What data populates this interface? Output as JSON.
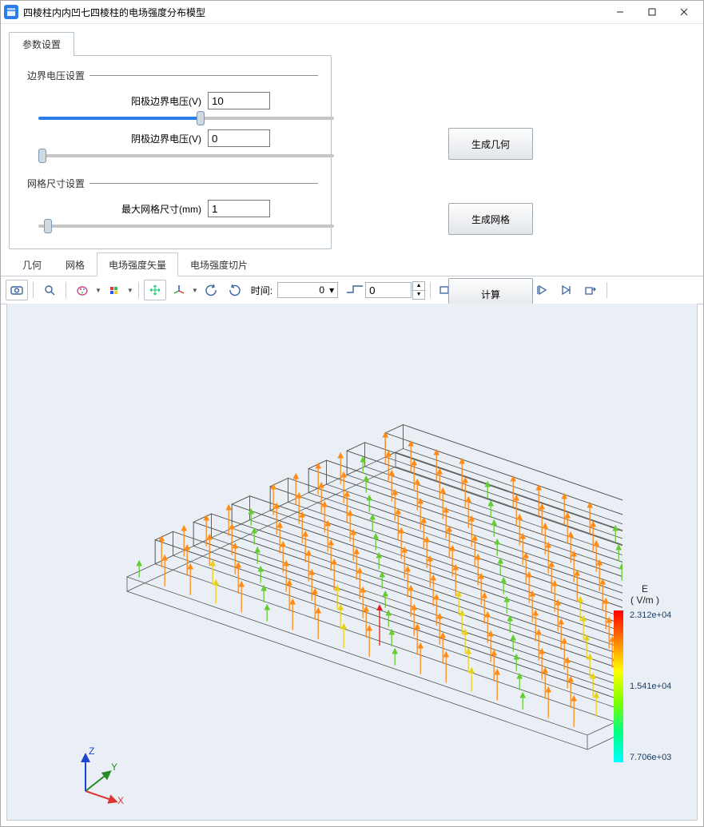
{
  "window": {
    "title": "四棱柱内内凹七四棱柱的电场强度分布模型"
  },
  "params_tab": "参数设置",
  "sections": {
    "voltage_title": "边界电压设置",
    "mesh_title": "网格尺寸设置"
  },
  "fields": {
    "anode_label": "阳极边界电压(V)",
    "anode_value": "10",
    "cathode_label": "阴极边界电压(V)",
    "cathode_value": "0",
    "mesh_label": "最大网格尺寸(mm)",
    "mesh_value": "1"
  },
  "actions": {
    "gen_geom": "生成几何",
    "gen_mesh": "生成网格",
    "compute": "计算"
  },
  "result_tabs": {
    "geom": "几何",
    "mesh": "网格",
    "vector": "电场强度矢量",
    "slice": "电场强度切片"
  },
  "toolbar": {
    "time_label": "时间:",
    "time_value": "0",
    "time_spin": "0"
  },
  "legend": {
    "title": "E",
    "unit": "( V/m )",
    "max": "2.312e+04",
    "mid": "1.541e+04",
    "min": "7.706e+03"
  },
  "axes": {
    "x": "X",
    "y": "Y",
    "z": "Z"
  }
}
